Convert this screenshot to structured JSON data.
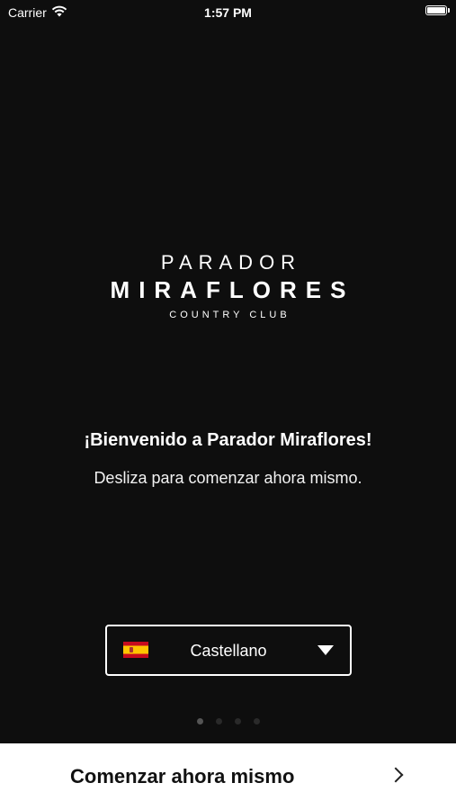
{
  "status_bar": {
    "carrier": "Carrier",
    "time": "1:57 PM",
    "icons": [
      "wifi-icon",
      "battery-icon"
    ]
  },
  "logo": {
    "line1": "PARADOR",
    "line2": "MIRAFLORES",
    "line3": "COUNTRY CLUB"
  },
  "welcome": {
    "title": "¡Bienvenido a Parador Miraflores!",
    "subtitle": "Desliza para comenzar ahora mismo."
  },
  "language_selector": {
    "selected": "Castellano",
    "flag_icon": "spain-flag-icon",
    "dropdown_icon": "caret-down-icon"
  },
  "pager": {
    "count": 4,
    "active_index": 0
  },
  "bottom_action": {
    "label": "Comenzar ahora mismo",
    "icon": "chevron-right-icon"
  },
  "colors": {
    "background": "#0e0e0e",
    "text": "#ffffff",
    "bottom_bar": "#ffffff",
    "bottom_text": "#111111"
  }
}
